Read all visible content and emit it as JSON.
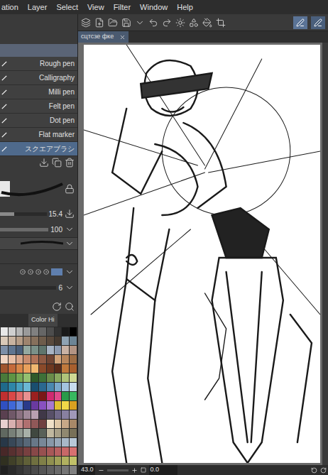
{
  "menu": [
    "ation",
    "Layer",
    "Select",
    "View",
    "Filter",
    "Window",
    "Help"
  ],
  "document_tab": {
    "title": "сцтсзе фке"
  },
  "brushes": [
    {
      "label": "Rough pen",
      "selected": false
    },
    {
      "label": "Calligraphy",
      "selected": false
    },
    {
      "label": "Milli pen",
      "selected": false
    },
    {
      "label": "Felt pen",
      "selected": false
    },
    {
      "label": "Dot pen",
      "selected": false
    },
    {
      "label": "Flat marker",
      "selected": false
    },
    {
      "label": "スクエアブラシ",
      "selected": true
    }
  ],
  "settings": {
    "size": "15.4",
    "size_level": 0.3,
    "opacity": "100",
    "opacity_level": 1.0,
    "count": "6"
  },
  "palette": {
    "tab": "Color Hi",
    "colors": [
      "#e8e8e8",
      "#cfcfcf",
      "#b5b5b5",
      "#9a9a9a",
      "#808080",
      "#666666",
      "#4d4d4d",
      "#333333",
      "#1a1a1a",
      "#000000",
      "#d9c9b8",
      "#c8b3a0",
      "#b59c86",
      "#9e846e",
      "#86705c",
      "#6e5c4b",
      "#5a4a3d",
      "#463a30",
      "#8fa3b3",
      "#6d8596",
      "#7d8fa8",
      "#5f7590",
      "#4a5f7a",
      "#94a8a0",
      "#7a9088",
      "#5f756d",
      "#a8b4c4",
      "#8c9ab0",
      "#c9b2a4",
      "#b39483",
      "#f2d6c4",
      "#e8bfa6",
      "#d9a68a",
      "#c98c6e",
      "#b07358",
      "#8f5a44",
      "#704534",
      "#d1a37a",
      "#b8865c",
      "#9c6c44",
      "#a0552e",
      "#c46a3a",
      "#d98648",
      "#e8a05c",
      "#f0b870",
      "#8a4a2a",
      "#6e3820",
      "#5a2c1a",
      "#c0793c",
      "#a85f2e",
      "#4a7a3a",
      "#5e9444",
      "#78aa56",
      "#94c070",
      "#2f5a2a",
      "#3e7038",
      "#6a8c4a",
      "#8aa860",
      "#b0c47a",
      "#cfd894",
      "#1f6a8a",
      "#2e86a8",
      "#48a0c0",
      "#6cb8d4",
      "#1a4e6e",
      "#2a6890",
      "#4a88b0",
      "#7aa8cc",
      "#a4c4e0",
      "#c8dcee",
      "#c03030",
      "#d84848",
      "#e06a6a",
      "#e89090",
      "#9a2020",
      "#7a1818",
      "#d02a70",
      "#e04a8a",
      "#2a9a4a",
      "#38b860",
      "#3050c0",
      "#4068d8",
      "#6088e0",
      "#2a3a8a",
      "#6a3aa0",
      "#8850c0",
      "#a878d0",
      "#e0c030",
      "#f0d848",
      "#d8a020",
      "#5a4050",
      "#705868",
      "#8a7080",
      "#a08898",
      "#b8a0b0",
      "#403848",
      "#585068",
      "#706888",
      "#8880a0",
      "#a098b8",
      "#e8d0d0",
      "#d8b0b0",
      "#c89090",
      "#b07070",
      "#905858",
      "#704040",
      "#f0e0c8",
      "#e0c8a8",
      "#c8a888",
      "#a88868",
      "#606860",
      "#788078",
      "#909890",
      "#a8b0a8",
      "#404840",
      "#586058",
      "#c0b8a0",
      "#a8a088",
      "#908870",
      "#787058",
      "#283848",
      "#384858",
      "#485868",
      "#586878",
      "#687888",
      "#788898",
      "#8898a8",
      "#98a8b8",
      "#a8b8c8",
      "#b8c8d8",
      "#482828",
      "#583030",
      "#683838",
      "#784040",
      "#884848",
      "#985050",
      "#a85858",
      "#b86060",
      "#c86868",
      "#d87070",
      "#303020",
      "#404028",
      "#505030",
      "#606038",
      "#707040",
      "#808048",
      "#909050",
      "#a0a058",
      "#b0b060",
      "#c0c068",
      "#202020",
      "#2a2a2a",
      "#353535",
      "#404040",
      "#4a4a4a",
      "#555555",
      "#606060",
      "#6a6a6a",
      "#757575",
      "#808080"
    ]
  },
  "status_bar": {
    "zoom": "43.0",
    "angle": "0.0"
  }
}
